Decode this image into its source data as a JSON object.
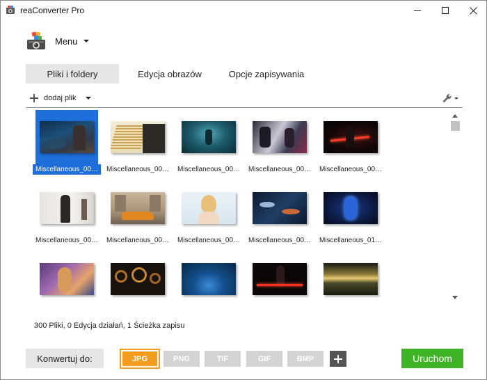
{
  "window": {
    "title": "reaConverter Pro",
    "icons": {
      "app": "camera-app-icon",
      "minimize": "minimize-icon",
      "maximize": "maximize-icon",
      "close": "close-icon"
    }
  },
  "menu": {
    "label": "Menu",
    "logo": "reaconverter-logo-icon"
  },
  "tabs": [
    {
      "label": "Pliki i foldery",
      "active": true
    },
    {
      "label": "Edycja obrazów",
      "active": false
    },
    {
      "label": "Opcje zapisywania",
      "active": false
    }
  ],
  "toolbar": {
    "add_file_label": "dodaj plik",
    "settings_icon": "wrench-icon"
  },
  "files": [
    {
      "name": "Miscellaneous_00…",
      "selected": true,
      "thumb": "dark-fantasy-warrior"
    },
    {
      "name": "Miscellaneous_00…",
      "selected": false,
      "thumb": "stack-of-books"
    },
    {
      "name": "Miscellaneous_00…",
      "selected": false,
      "thumb": "underwater-teal-scene"
    },
    {
      "name": "Miscellaneous_00…",
      "selected": false,
      "thumb": "anime-characters"
    },
    {
      "name": "Miscellaneous_00…",
      "selected": false,
      "thumb": "red-lightsaber-dark"
    },
    {
      "name": "Miscellaneous_00…",
      "selected": false,
      "thumb": "woman-in-white-room"
    },
    {
      "name": "Miscellaneous_00…",
      "selected": false,
      "thumb": "orange-sports-car-street"
    },
    {
      "name": "Miscellaneous_00…",
      "selected": false,
      "thumb": "blonde-woman-portrait"
    },
    {
      "name": "Miscellaneous_00…",
      "selected": false,
      "thumb": "space-battle-ships"
    },
    {
      "name": "Miscellaneous_01…",
      "selected": false,
      "thumb": "blue-neon-figure"
    },
    {
      "name": "",
      "selected": false,
      "thumb": "purple-fantasy-woman"
    },
    {
      "name": "",
      "selected": false,
      "thumb": "dark-mechanical-gears"
    },
    {
      "name": "",
      "selected": false,
      "thumb": "blue-gradient-tunnel"
    },
    {
      "name": "",
      "selected": false,
      "thumb": "red-lightsaber-warrior"
    },
    {
      "name": "",
      "selected": false,
      "thumb": "golden-sky-landscape"
    }
  ],
  "status": "300 Pliki, 0 Edycja działań, 1 Ścieżka zapisu",
  "convert": {
    "label": "Konwertuj do:",
    "formats": [
      {
        "label": "JPG",
        "active": true
      },
      {
        "label": "PNG",
        "active": false
      },
      {
        "label": "TIF",
        "active": false
      },
      {
        "label": "GIF",
        "active": false
      },
      {
        "label": "BMP",
        "active": false
      }
    ],
    "add_icon": "plus-icon"
  },
  "run_label": "Uruchom",
  "colors": {
    "accent_orange": "#f39c1f",
    "run_green": "#3db325",
    "selection_blue": "#1e6fd9",
    "tab_active_bg": "#e6e6e6"
  }
}
